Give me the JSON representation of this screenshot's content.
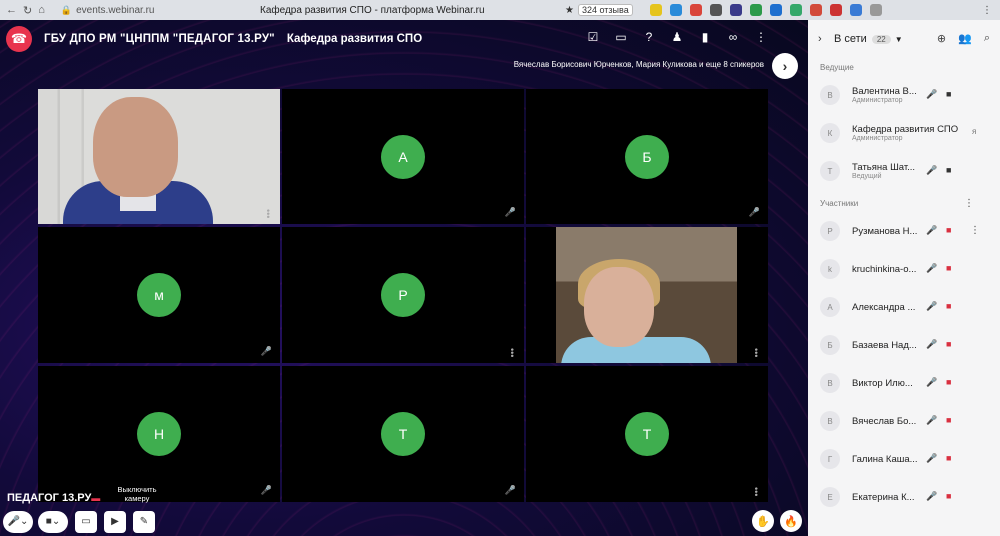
{
  "browser": {
    "url": "events.webinar.ru",
    "title": "Кафедра развития СПО - платформа Webinar.ru",
    "rating": "324 отзыва"
  },
  "header": {
    "org": "ГБУ ДПО РМ \"ЦНППМ \"ПЕДАГОГ 13.РУ\"",
    "room": "Кафедра развития СПО",
    "speakers": "Вячеслав Борисович Юрченков, Мария Куликова и еще 8 спикеров"
  },
  "tiles": [
    {
      "type": "video",
      "label": ""
    },
    {
      "type": "avatar",
      "letter": "А",
      "muted": true
    },
    {
      "type": "avatar",
      "letter": "Б",
      "muted": true
    },
    {
      "type": "avatar",
      "letter": "м",
      "muted": true
    },
    {
      "type": "avatar",
      "letter": "Р",
      "muted": false
    },
    {
      "type": "video",
      "label": ""
    },
    {
      "type": "avatar",
      "letter": "Н",
      "muted": false
    },
    {
      "type": "avatar",
      "letter": "Т",
      "muted": true
    },
    {
      "type": "avatar",
      "letter": "Т",
      "muted": false
    }
  ],
  "controls": {
    "cam_tooltip": "Выключить камеру",
    "brand": "ПЕДАГОГ 13.РУ"
  },
  "sidebar": {
    "online_label": "В сети",
    "online_count": "22",
    "hosts_label": "Ведущие",
    "participants_label": "Участники",
    "hosts": [
      {
        "initial": "В",
        "name": "Валентина В...",
        "role": "Администратор"
      },
      {
        "initial": "К",
        "name": "Кафедра развития СПО",
        "role": "Администратор"
      },
      {
        "initial": "Т",
        "name": "Татьяна Шат...",
        "role": "Ведущий"
      }
    ],
    "participants": [
      {
        "initial": "Р",
        "name": "Рузманова Н..."
      },
      {
        "initial": "k",
        "name": "kruchinkina-o..."
      },
      {
        "initial": "А",
        "name": "Александра ..."
      },
      {
        "initial": "Б",
        "name": "Базаева Над..."
      },
      {
        "initial": "В",
        "name": "Виктор Илю..."
      },
      {
        "initial": "В",
        "name": "Вячеслав Бо..."
      },
      {
        "initial": "Г",
        "name": "Галина Каша..."
      },
      {
        "initial": "Е",
        "name": "Екатерина К..."
      }
    ]
  }
}
